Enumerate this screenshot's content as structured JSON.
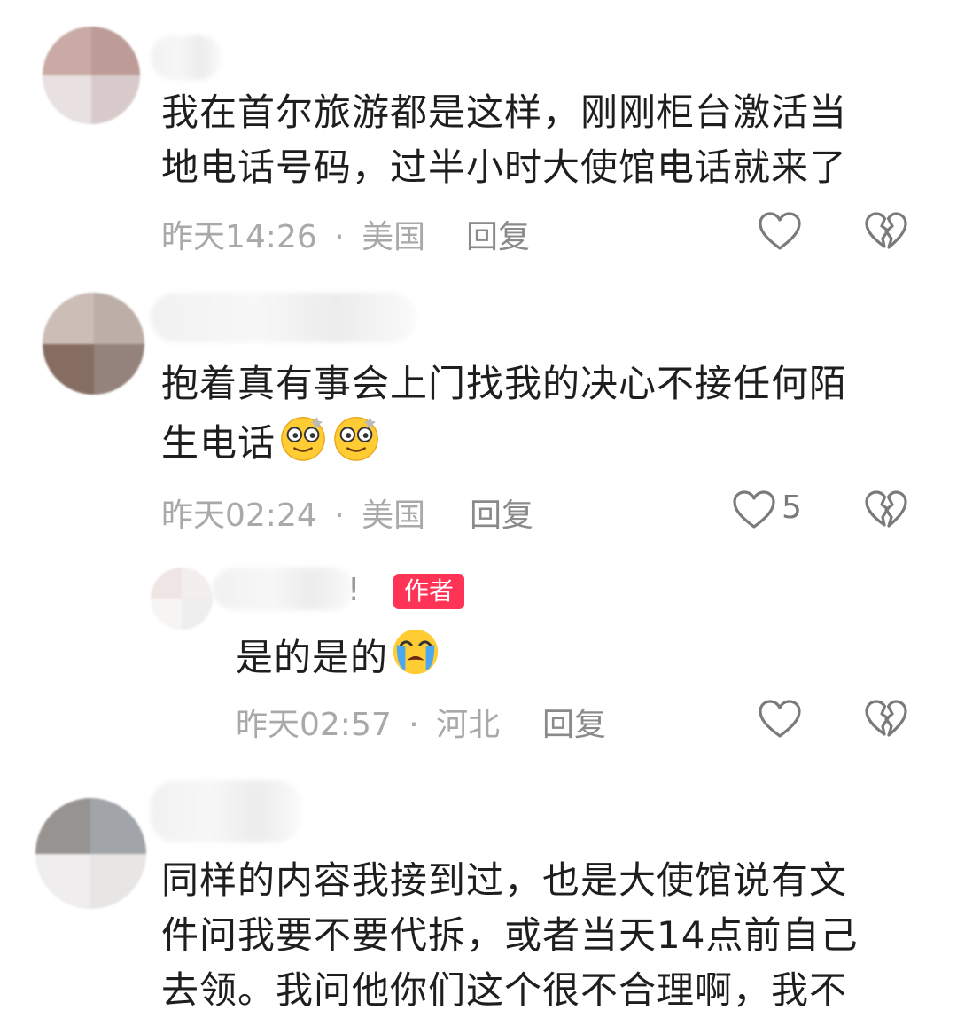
{
  "comments": [
    {
      "text_lines": [
        "我在首尔旅游都是这样，刚刚柜台激活当",
        "地电话号码，过半小时大使馆电话就来了"
      ],
      "time": "昨天14:26",
      "separator": "·",
      "location": "美国",
      "reply_label": "回复",
      "like_count": ""
    },
    {
      "text_lines": [
        "抱着真有事会上门找我的决心不接任何陌",
        "生电话"
      ],
      "time": "昨天02:24",
      "separator": "·",
      "location": "美国",
      "reply_label": "回复",
      "like_count": "5"
    },
    {
      "username_suffix": "!",
      "badge": "作者",
      "text_lines": [
        "是的是的"
      ],
      "time": "昨天02:57",
      "separator": "·",
      "location": "河北",
      "reply_label": "回复",
      "like_count": ""
    },
    {
      "text_lines": [
        "同样的内容我接到过，也是大使馆说有文",
        "件问我要不要代拆，或者当天14点前自己",
        "去领。我问他你们这个很不合理啊，我不"
      ]
    }
  ],
  "icons": {
    "like": "heart-outline-icon",
    "dislike": "broken-heart-icon",
    "emoji_dizzy": "dizzy-face-emoji",
    "emoji_crying": "loudly-crying-emoji"
  },
  "colors": {
    "text": "#1e1e1e",
    "meta": "#a9a9a9",
    "badge": "#ff3355"
  }
}
